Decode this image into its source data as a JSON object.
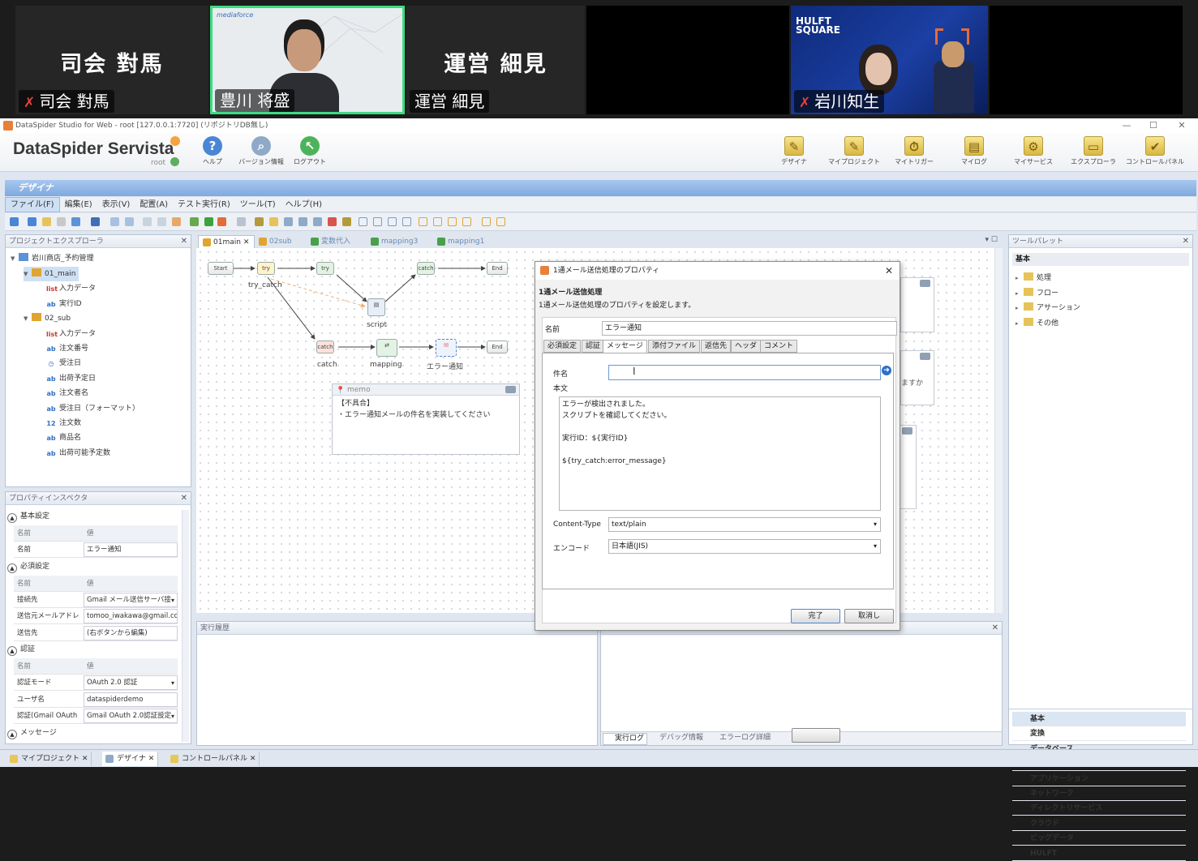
{
  "video": {
    "tiles": [
      {
        "big_name": "司会 對馬",
        "tag": "司会 對馬",
        "muted": true
      },
      {
        "big_name": "",
        "tag": "豊川 将盛",
        "muted": false
      },
      {
        "big_name": "運営 細見",
        "tag": "運営 細見",
        "muted": false
      },
      {
        "big_name": "",
        "tag": "",
        "muted": false
      },
      {
        "big_name": "",
        "tag": "岩川知生",
        "muted": true
      }
    ],
    "badge_text": {
      "line1": "HULFT",
      "line2": "SQUARE"
    },
    "slide_logo": "mediaforce"
  },
  "window": {
    "title": "DataSpider Studio for Web - root [127.0.0.1:7720] (リポジトリDB無し)",
    "controls": {
      "minimize": "—",
      "maximize": "☐",
      "close": "✕"
    }
  },
  "brand": {
    "name": "DataSpider Servista",
    "user": "root"
  },
  "top_toolbar": {
    "left": [
      "ヘルプ",
      "バージョン情報",
      "ログアウト"
    ],
    "right": [
      "デザイナ",
      "マイプロジェクト",
      "マイトリガー",
      "マイログ",
      "マイサービス",
      "エクスプローラ",
      "コントロールパネル"
    ]
  },
  "designer_bar": "デザイナ",
  "menu": [
    "ファイル(F)",
    "編集(E)",
    "表示(V)",
    "配置(A)",
    "テスト実行(R)",
    "ツール(T)",
    "ヘルプ(H)"
  ],
  "explorer": {
    "title": "プロジェクトエクスプローラ",
    "project": "岩川商店_予約管理",
    "items": [
      {
        "label": "01_main",
        "level": 1,
        "icon": "script"
      },
      {
        "label": "入力データ",
        "level": 2,
        "icon": "var-list"
      },
      {
        "label": "実行ID",
        "level": 2,
        "icon": "var-string"
      },
      {
        "label": "02_sub",
        "level": 1,
        "icon": "script"
      },
      {
        "label": "入力データ",
        "level": 2,
        "icon": "var-list"
      },
      {
        "label": "注文番号",
        "level": 2,
        "icon": "var-string"
      },
      {
        "label": "受注日",
        "level": 2,
        "icon": "var-date"
      },
      {
        "label": "出荷予定日",
        "level": 2,
        "icon": "var-string"
      },
      {
        "label": "注文者名",
        "level": 2,
        "icon": "var-string"
      },
      {
        "label": "受注日（フォーマット）",
        "level": 2,
        "icon": "var-string"
      },
      {
        "label": "注文数",
        "level": 2,
        "icon": "var-int"
      },
      {
        "label": "商品名",
        "level": 2,
        "icon": "var-string"
      },
      {
        "label": "出荷可能予定数",
        "level": 2,
        "icon": "var-string"
      }
    ]
  },
  "inspector": {
    "title": "プロパティインスペクタ",
    "col_name": "名前",
    "col_value": "値",
    "sections": [
      {
        "title": "基本設定",
        "rows": [
          {
            "k": "名前",
            "v": "エラー通知"
          }
        ]
      },
      {
        "title": "必須設定",
        "rows": [
          {
            "k": "接続先",
            "v": "Gmail メール送信サーバ接"
          },
          {
            "k": "送信元メールアドレ",
            "v": "tomoo_iwakawa@gmail.com"
          },
          {
            "k": "送信先",
            "v": "(右ボタンから編集)"
          }
        ]
      },
      {
        "title": "認証",
        "rows": [
          {
            "k": "認証モード",
            "v": "OAuth 2.0 認証"
          },
          {
            "k": "ユーザ名",
            "v": "dataspiderdemo"
          },
          {
            "k": "認証(Gmail OAuth",
            "v": "Gmail OAuth 2.0認証設定"
          }
        ]
      },
      {
        "title": "メッセージ",
        "rows": []
      }
    ]
  },
  "tabs": [
    {
      "label": "01main",
      "active": true,
      "color": "#e0a52f"
    },
    {
      "label": "02sub",
      "active": false,
      "color": "#e0a52f"
    },
    {
      "label": "変数代入",
      "active": false,
      "color": "#4aa04a"
    },
    {
      "label": "mapping3",
      "active": false,
      "color": "#4aa04a"
    },
    {
      "label": "mapping1",
      "active": false,
      "color": "#4aa04a"
    }
  ],
  "flow": {
    "nodes": {
      "start": "Start",
      "try": "try",
      "catch_top": "catch",
      "end_top": "End",
      "try_catch_label": "try_catch",
      "script_label": "script",
      "catch_bottom": "catch",
      "mapping_label": "mapping",
      "mail_label": "エラー通知",
      "end_bottom": "End",
      "try_catch_node": "try"
    },
    "memo": {
      "title": "memo",
      "line1": "【不具合】",
      "line2": "・エラー通知メールの件名を実装してください"
    },
    "right_hint": "ますか"
  },
  "dialog": {
    "title": "1通メール送信処理のプロパティ",
    "heading": "1通メール送信処理",
    "subtitle": "1通メール送信処理のプロパティを設定します。",
    "name_label": "名前",
    "name_value": "エラー通知",
    "tabs": [
      "必須設定",
      "認証",
      "メッセージ",
      "添付ファイル",
      "返信先",
      "ヘッダ",
      "コメント"
    ],
    "subject_label": "件名",
    "subject_value": "",
    "body_label": "本文",
    "body_lines": [
      "エラーが検出されました。",
      "スクリプトを確認してください。",
      "",
      "実行ID：${実行ID}",
      "",
      "${try_catch:error_message}"
    ],
    "content_type_label": "Content-Type",
    "content_type_value": "text/plain",
    "encoding_label": "エンコード",
    "encoding_value": "日本語(JIS)",
    "ok": "完了",
    "cancel": "取消し"
  },
  "history": {
    "title": "実行履歴"
  },
  "log": {
    "title": "実行ログ",
    "tabs": [
      "実行ログ",
      "デバッグ情報",
      "エラーログ詳細"
    ]
  },
  "palette": {
    "title": "ツールパレット",
    "section": "基本",
    "tree": [
      "処理",
      "フロー",
      "アサーション",
      "その他"
    ],
    "categories": [
      "基本",
      "変換",
      "データベース",
      "ファイル",
      "アプリケーション",
      "ネットワーク",
      "ディレクトリサービス",
      "クラウド",
      "ビッグデータ",
      "HULFT"
    ]
  },
  "statusbar": [
    "マイプロジェクト",
    "デザイナ",
    "コントロールパネル"
  ],
  "colors": {
    "accent": "#7fa9de",
    "zoom_active_border": "#3ddc84",
    "mute": "#e8413a"
  }
}
